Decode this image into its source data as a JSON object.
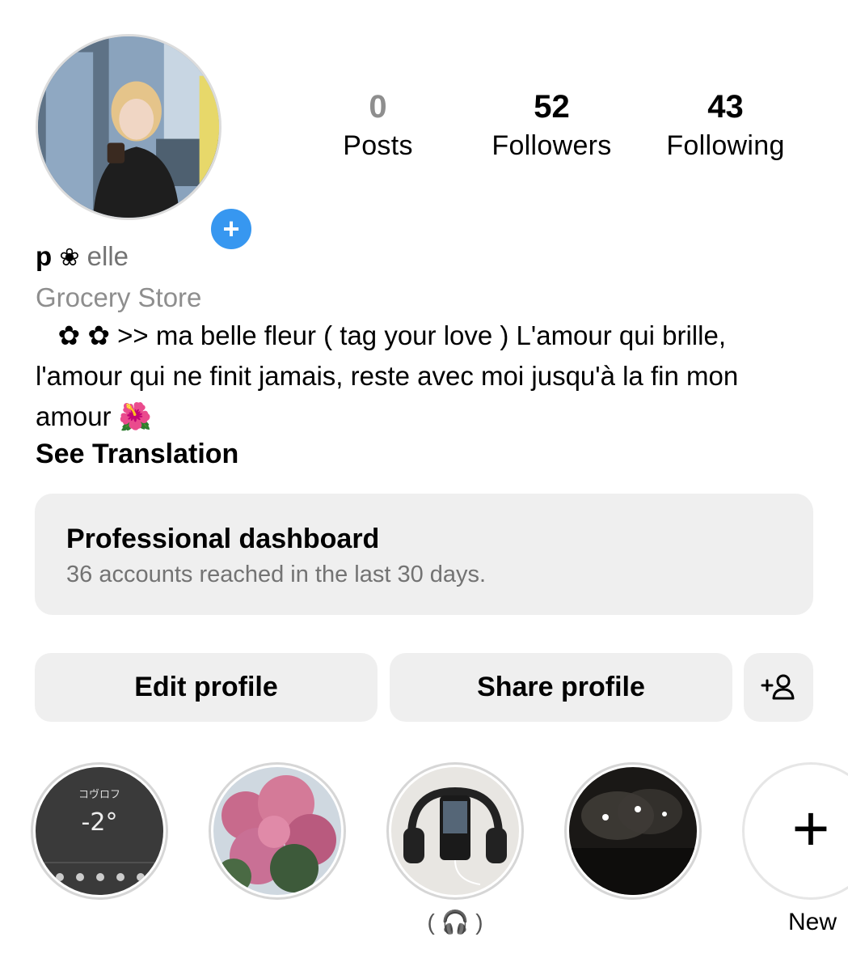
{
  "profile": {
    "name_initial": "p",
    "name_flower": "❀",
    "name_rest": "elle",
    "category": "Grocery Store",
    "bio": "   ✿ ✿ >> ma belle fleur ( tag your love ) L'amour qui brille, l'amour qui ne finit jamais, reste avec moi jusqu'à la fin mon amour 🌺",
    "see_translation": "See Translation",
    "add_story_symbol": "+"
  },
  "stats": {
    "posts": {
      "value": "0",
      "label": "Posts"
    },
    "followers": {
      "value": "52",
      "label": "Followers"
    },
    "following": {
      "value": "43",
      "label": "Following"
    }
  },
  "dashboard": {
    "title": "Professional dashboard",
    "subtitle": "36 accounts reached in the last 30 days."
  },
  "buttons": {
    "edit": "Edit profile",
    "share": "Share profile"
  },
  "highlights": {
    "items": [
      {
        "label": ""
      },
      {
        "label": ""
      },
      {
        "label": "( 🎧 )"
      },
      {
        "label": ""
      }
    ],
    "new_label": "New",
    "new_symbol": "+",
    "weather_text": "コヴロフ",
    "weather_temp": "-2°"
  },
  "colors": {
    "accent": "#3797f0",
    "button_bg": "#efefef",
    "muted_text": "#737373"
  }
}
